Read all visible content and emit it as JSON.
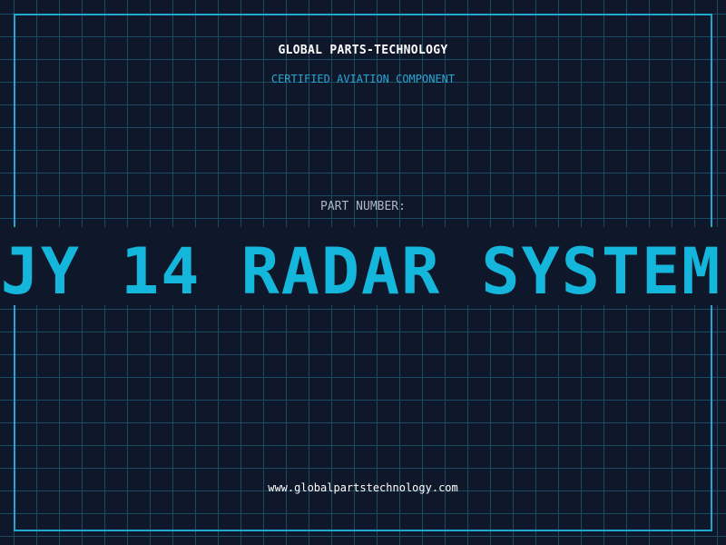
{
  "header": {
    "company": "GLOBAL PARTS-TECHNOLOGY",
    "tagline": "CERTIFIED AVIATION COMPONENT"
  },
  "part": {
    "label": "PART NUMBER:",
    "number": "JY 14 RADAR SYSTEM"
  },
  "footer": {
    "website": "www.globalpartstechnology.com"
  },
  "colors": {
    "background": "#0f172a",
    "grid": "#1c4a5e",
    "frame": "#1fa8cf",
    "accent": "#14b6db",
    "tagline": "#2aa6d3",
    "label": "#aeb6c4",
    "text": "#ffffff"
  }
}
